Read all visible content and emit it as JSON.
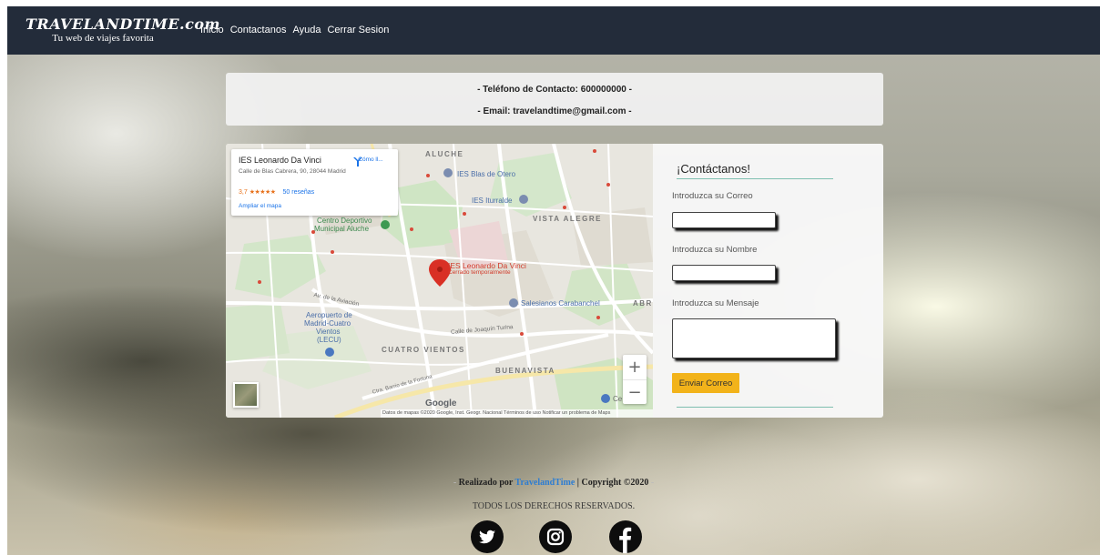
{
  "navbar": {
    "brand_name": "TRAVELANDTIME.com",
    "brand_tagline": "Tu web de viajes favorita",
    "links": [
      "Inicio",
      "Contactanos",
      "Ayuda",
      "Cerrar Sesion"
    ]
  },
  "contact_info": {
    "phone_line": "- Teléfono de Contacto: 600000000 -",
    "email_line": "- Email: travelandtime@gmail.com -"
  },
  "map": {
    "place_card": {
      "name": "IES Leonardo Da Vinci",
      "address": "Calle de Blas Cabrera, 90, 28044 Madrid",
      "rating": "3,7",
      "stars": "★★★★★",
      "reviews": "50 reseñas",
      "expand": "Ampliar el mapa",
      "directions": "Cómo ll..."
    },
    "labels": {
      "aluche": "ALUCHE",
      "ies_blas": "IES Blas de Otero",
      "ies_iturralde": "IES Iturralde",
      "vista_alegre": "VISTA ALEGRE",
      "centro_deportivo_1": "Centro Deportivo",
      "centro_deportivo_2": "Municipal Aluche",
      "ies_leonardo": "IES Leonardo Da Vinci",
      "cerrado": "Cerrado temporalmente",
      "salesianos": "Salesianos Carabanchel",
      "abr": "ABR",
      "aeropuerto_1": "Aeropuerto de",
      "aeropuerto_2": "Madrid-Cuatro",
      "aeropuerto_3": "Vientos",
      "aeropuerto_4": "(LECU)",
      "cuatro_vientos": "CUATRO VIENTOS",
      "buenavista": "BUENAVISTA",
      "av_aviacion": "Av. de la Aviación",
      "joaquin_turina": "Calle de Joaquín Turina",
      "carretera": "Ctra. Barrio de la Fortuna",
      "ce": "Ce",
      "google": "Google"
    },
    "zoom_in": "+",
    "zoom_out": "−",
    "footer": "Datos de mapas ©2020 Google, Inst. Geogr. Nacional   Términos de uso   Notificar un problema de Maps"
  },
  "form": {
    "title": "¡Contáctanos!",
    "email_label": "Introduzca su Correo",
    "name_label": "Introduzca su Nombre",
    "message_label": "Introduzca su Mensaje",
    "submit_label": "Enviar Correo"
  },
  "footer": {
    "dash_left": "-",
    "made_by": "Realizado por ",
    "brand": "TravelandTime",
    "copyright": " | Copyright ©2020 ",
    "dash_right": "-",
    "rights": "TODOS LOS DERECHOS RESERVADOS."
  },
  "colors": {
    "navbar_bg": "#232c3a",
    "button_bg": "#f2b31a",
    "link_blue": "#2d7dd2",
    "pin_red": "#d93025"
  },
  "icons": {
    "social": [
      "twitter-icon",
      "instagram-icon",
      "facebook-icon"
    ]
  }
}
